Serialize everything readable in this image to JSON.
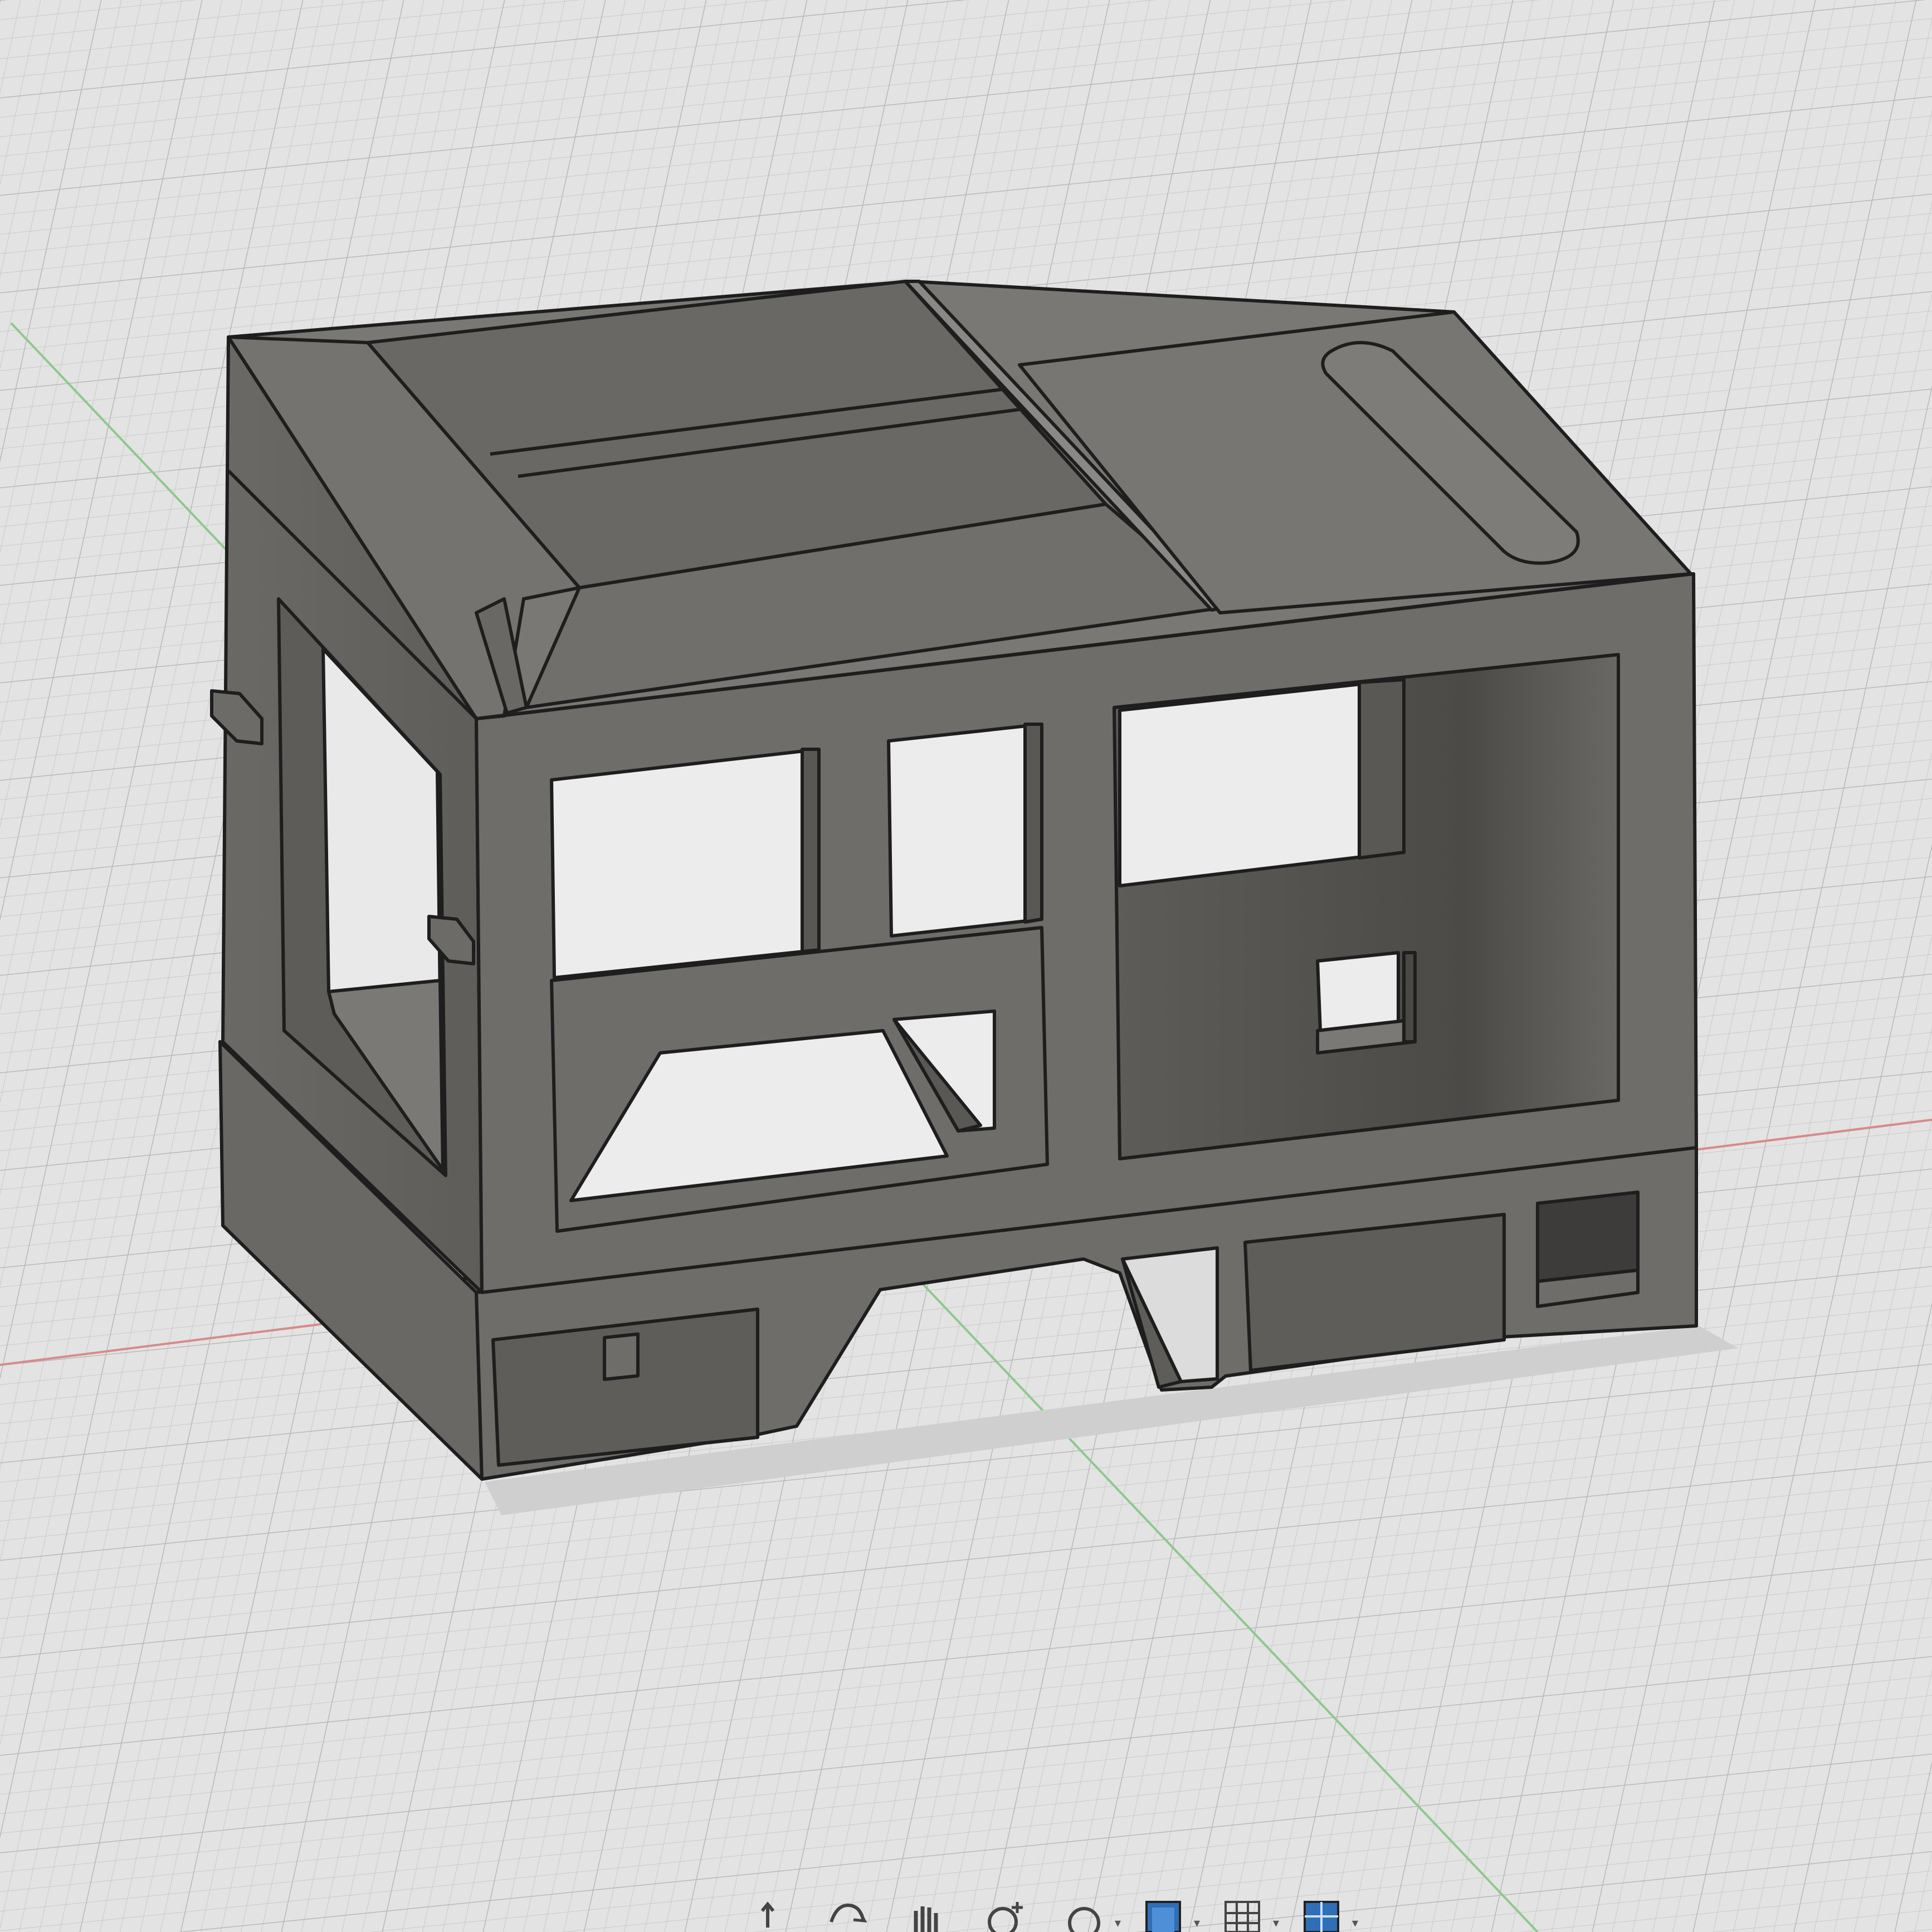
{
  "app": {
    "view": "3d-model-viewport",
    "grid_visible": true,
    "background_color": "#e2e2e2",
    "model_color": "#6f6d69"
  },
  "axes": {
    "x_axis_color": "#d88a8a",
    "y_axis_color": "#8cc98c"
  },
  "model": {
    "name_icon": "locomotive-cab-body-icon"
  },
  "toolbar": {
    "items": [
      {
        "name": "orbit-icon"
      },
      {
        "name": "pan-hand-icon"
      },
      {
        "name": "zoom-icon"
      },
      {
        "name": "fit-window-icon"
      },
      {
        "name": "display-settings-icon"
      },
      {
        "name": "grid-settings-icon"
      },
      {
        "name": "viewports-icon"
      }
    ]
  }
}
